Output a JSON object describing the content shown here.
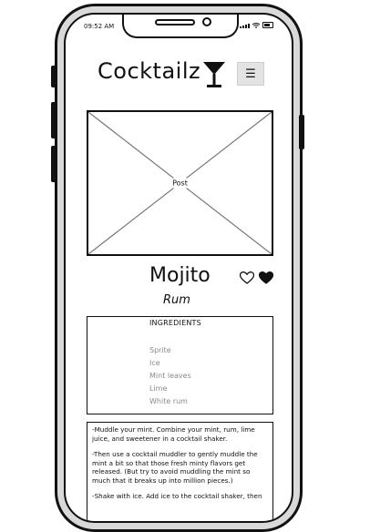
{
  "status_bar": {
    "time": "09:52 AM"
  },
  "header": {
    "title": "Cocktailz",
    "menu_icon": "hamburger-icon",
    "logo_icon": "cocktail-glass-icon"
  },
  "image": {
    "label": "Post"
  },
  "drink": {
    "name": "Mojito",
    "base_spirit": "Rum",
    "favorite_icons": [
      "heart-outline-icon",
      "heart-filled-icon"
    ]
  },
  "ingredients": {
    "heading": "INGREDIENTS",
    "items": [
      "Sprite",
      "Ice",
      "Mint leaves",
      "Lime",
      "White rum"
    ]
  },
  "instructions": {
    "steps": [
      "-Muddle your mint. Combine your mint, rum, lime juice, and sweetener in a cocktail shaker.",
      "-Then use a cocktail muddler to gently muddle the mint a bit so that those fresh minty flavors get released. (But try to avoid muddling the mint so much that it breaks up into million pieces.)",
      "-Shake with ice. Add ice to the cocktail shaker, then"
    ]
  },
  "colors": {
    "frame": "#111111",
    "frame_fill": "#d9d9d9",
    "menu_button_bg": "#e3e3e3",
    "ingredient_text": "#8a8a8a"
  }
}
